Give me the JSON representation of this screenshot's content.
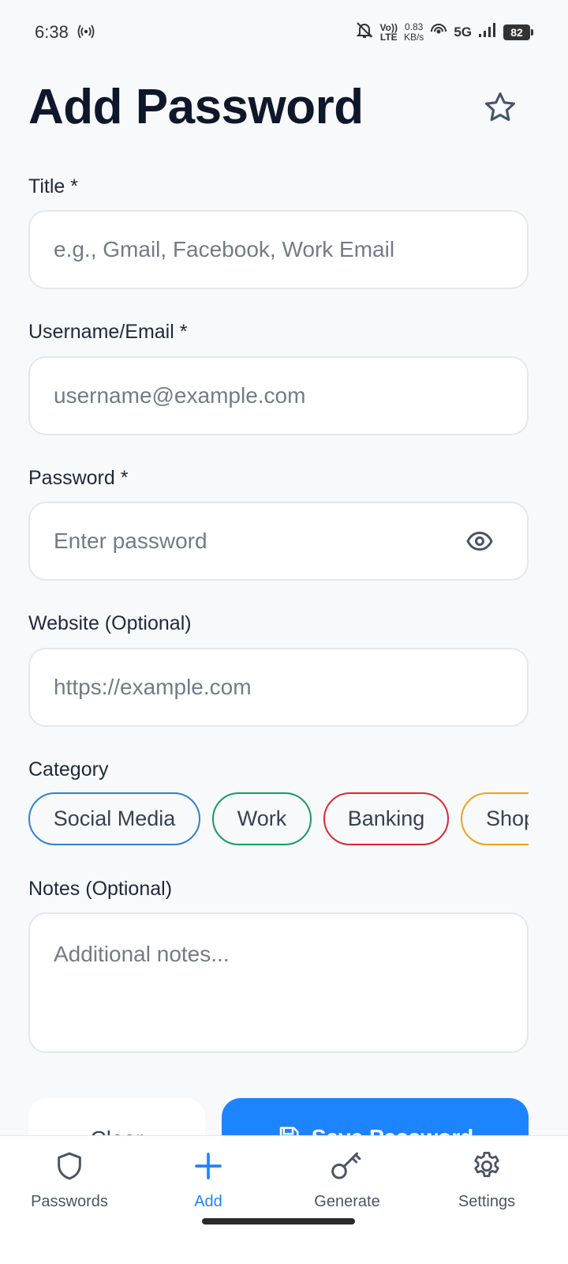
{
  "status_bar": {
    "time": "6:38",
    "network_speed_value": "0.83",
    "network_speed_unit": "KB/s",
    "volte_top": "Vo))",
    "volte_bottom": "LTE",
    "network_type": "5G",
    "battery": "82"
  },
  "header": {
    "title": "Add Password",
    "favorite_icon": "star-outline-icon"
  },
  "form": {
    "title": {
      "label": "Title *",
      "placeholder": "e.g., Gmail, Facebook, Work Email",
      "value": ""
    },
    "username": {
      "label": "Username/Email *",
      "placeholder": "username@example.com",
      "value": ""
    },
    "password": {
      "label": "Password *",
      "placeholder": "Enter password",
      "value": "",
      "toggle_icon": "eye-icon"
    },
    "website": {
      "label": "Website (Optional)",
      "placeholder": "https://example.com",
      "value": ""
    },
    "category": {
      "label": "Category",
      "options": [
        {
          "label": "Social Media",
          "color": "#2f80d0"
        },
        {
          "label": "Work",
          "color": "#169b62"
        },
        {
          "label": "Banking",
          "color": "#d62b33"
        },
        {
          "label": "Shop",
          "color": "#f0a21b"
        }
      ]
    },
    "notes": {
      "label": "Notes (Optional)",
      "placeholder": "Additional notes...",
      "value": ""
    }
  },
  "actions": {
    "clear_label": "Clear",
    "save_label": "Save Password",
    "save_icon": "save-icon",
    "save_color": "#1d84ff"
  },
  "bottom_nav": {
    "items": [
      {
        "label": "Passwords",
        "icon": "shield-icon",
        "active": false
      },
      {
        "label": "Add",
        "icon": "plus-icon",
        "active": true
      },
      {
        "label": "Generate",
        "icon": "key-icon",
        "active": false
      },
      {
        "label": "Settings",
        "icon": "gear-icon",
        "active": false
      }
    ],
    "active_color": "#1d84ff"
  }
}
